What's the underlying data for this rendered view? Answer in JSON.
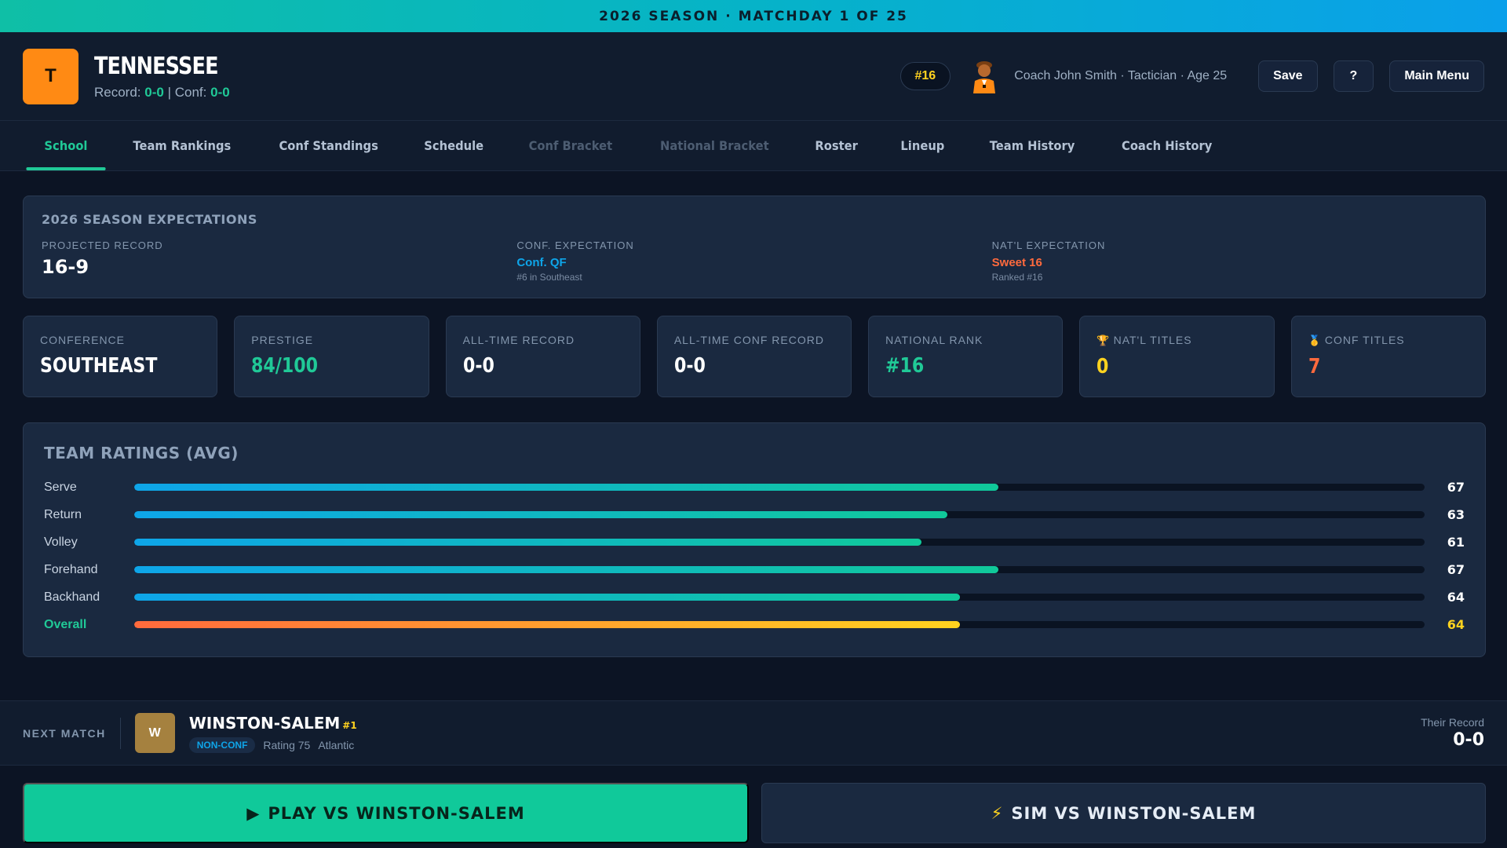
{
  "banner": {
    "text": "2026 SEASON · MATCHDAY 1 OF 25"
  },
  "header": {
    "logo_letter": "T",
    "team_name": "TENNESSEE",
    "record_label": "Record:",
    "record": "0-0",
    "separator": "|",
    "conf_label": "Conf:",
    "conf_record": "0-0",
    "rank_badge": "#16",
    "coach_text": "Coach John Smith · Tactician · Age 25",
    "save_label": "Save",
    "help_label": "?",
    "menu_label": "Main Menu"
  },
  "tabs": [
    {
      "label": "School",
      "state": "active"
    },
    {
      "label": "Team Rankings",
      "state": "normal"
    },
    {
      "label": "Conf Standings",
      "state": "normal"
    },
    {
      "label": "Schedule",
      "state": "normal"
    },
    {
      "label": "Conf Bracket",
      "state": "disabled"
    },
    {
      "label": "National Bracket",
      "state": "disabled"
    },
    {
      "label": "Roster",
      "state": "normal"
    },
    {
      "label": "Lineup",
      "state": "normal"
    },
    {
      "label": "Team History",
      "state": "normal"
    },
    {
      "label": "Coach History",
      "state": "normal"
    }
  ],
  "expectations": {
    "title": "2026 SEASON EXPECTATIONS",
    "projected": {
      "label": "PROJECTED RECORD",
      "value": "16-9"
    },
    "conf": {
      "label": "CONF. EXPECTATION",
      "value": "Conf. QF",
      "sub": "#6 in Southeast",
      "color": "#0ea5e9"
    },
    "natl": {
      "label": "NAT'L EXPECTATION",
      "value": "Sweet 16",
      "sub": "Ranked #16",
      "color": "#ff6a3d"
    }
  },
  "stats": [
    {
      "label": "CONFERENCE",
      "value": "SOUTHEAST",
      "color": "#ffffff",
      "icon": ""
    },
    {
      "label": "PRESTIGE",
      "value": "84/100",
      "color": "#20c997",
      "icon": ""
    },
    {
      "label": "ALL-TIME RECORD",
      "value": "0-0",
      "color": "#ffffff",
      "icon": ""
    },
    {
      "label": "ALL-TIME CONF RECORD",
      "value": "0-0",
      "color": "#ffffff",
      "icon": ""
    },
    {
      "label": "NATIONAL RANK",
      "value": "#16",
      "color": "#20c997",
      "icon": ""
    },
    {
      "label": "NAT'L TITLES",
      "value": "0",
      "color": "#ffd21f",
      "icon": "🏆"
    },
    {
      "label": "CONF TITLES",
      "value": "7",
      "color": "#ff6a3d",
      "icon": "🥇"
    }
  ],
  "ratings": {
    "title": "TEAM RATINGS (AVG)",
    "max": 100,
    "rows": [
      {
        "name": "Serve",
        "value": 67
      },
      {
        "name": "Return",
        "value": 63
      },
      {
        "name": "Volley",
        "value": 61
      },
      {
        "name": "Forehand",
        "value": 67
      },
      {
        "name": "Backhand",
        "value": 64
      },
      {
        "name": "Overall",
        "value": 64,
        "overall": true
      }
    ]
  },
  "next_match": {
    "label": "NEXT MATCH",
    "opp_letter": "W",
    "opp_name": "WINSTON-SALEM",
    "opp_rank": "#1",
    "tag": "NON-CONF",
    "rating": "Rating 75",
    "conference": "Atlantic",
    "their_record_label": "Their Record",
    "their_record": "0-0"
  },
  "actions": {
    "play_label": "PLAY VS WINSTON-SALEM",
    "sim_label": "SIM VS WINSTON-SALEM"
  }
}
